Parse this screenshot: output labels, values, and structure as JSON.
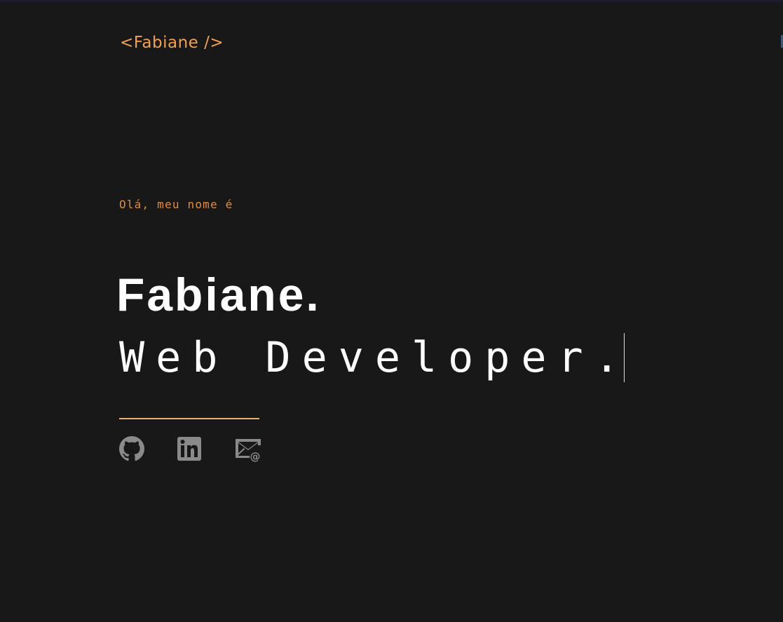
{
  "header": {
    "logo_text": "<Fabiane />"
  },
  "hero": {
    "greeting": "Olá, meu nome é",
    "name": "Fabiane.",
    "role": "Web Developer."
  },
  "social": [
    {
      "name": "GitHub",
      "icon": "github-icon"
    },
    {
      "name": "LinkedIn",
      "icon": "linkedin-icon"
    },
    {
      "name": "Email",
      "icon": "mail-at-icon"
    }
  ],
  "colors": {
    "background": "#181818",
    "accent": "#f0a050",
    "greeting": "#e08c3a",
    "divider": "#e8b070",
    "text": "#ffffff",
    "icon": "#8a8a8a"
  }
}
